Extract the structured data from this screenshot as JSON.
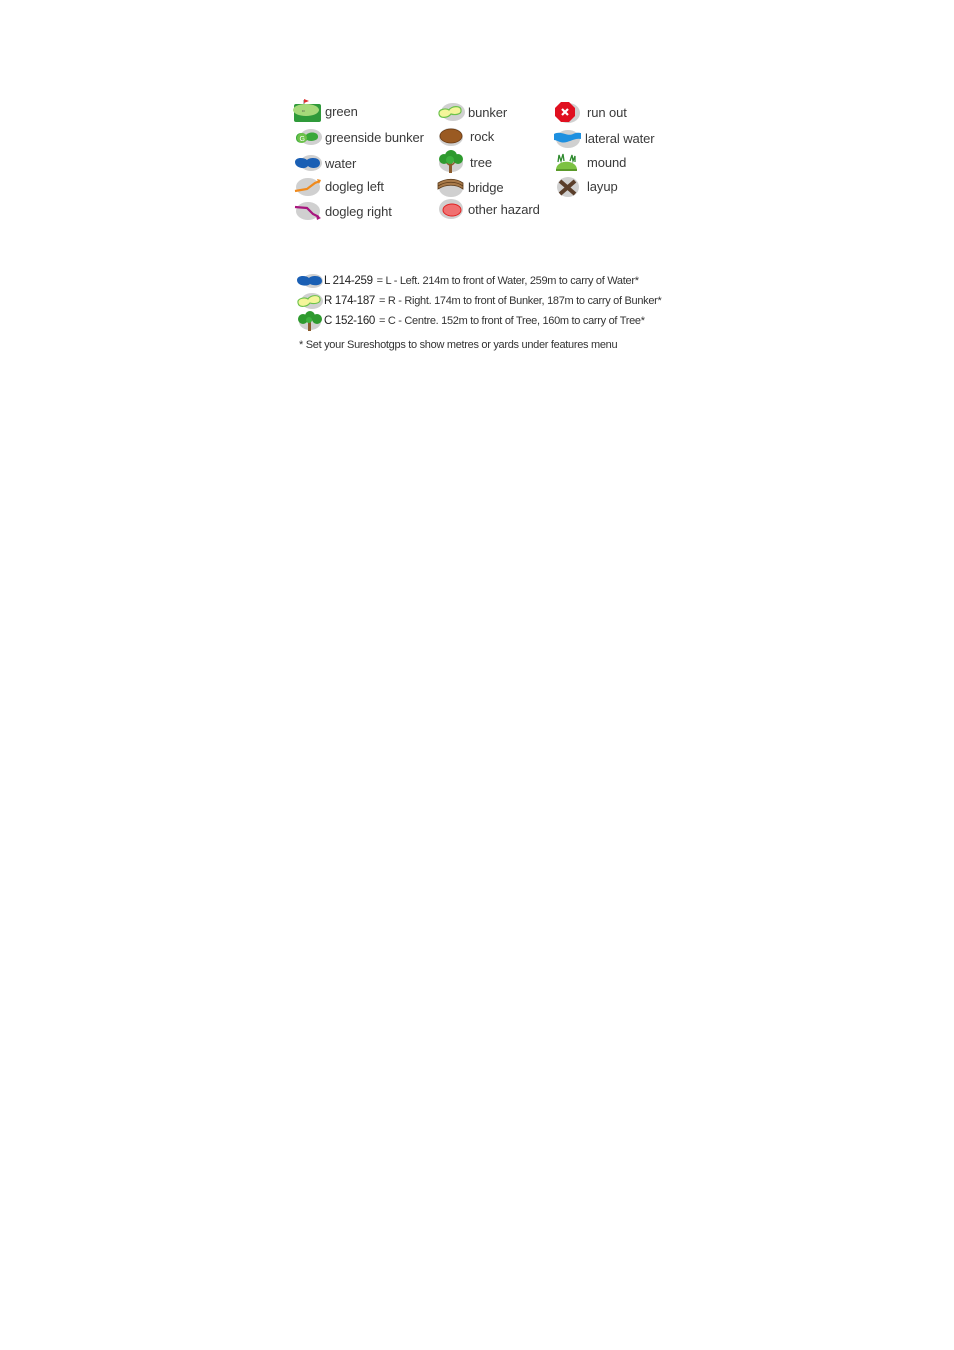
{
  "legend": {
    "columns": [
      {
        "items": [
          {
            "icon": "green-icon",
            "label": "green"
          },
          {
            "icon": "greenside-bunker-icon",
            "label": "greenside bunker"
          },
          {
            "icon": "water-icon",
            "label": "water"
          },
          {
            "icon": "dogleg-left-icon",
            "label": "dogleg left"
          },
          {
            "icon": "dogleg-right-icon",
            "label": "dogleg right"
          }
        ]
      },
      {
        "items": [
          {
            "icon": "bunker-icon",
            "label": "bunker"
          },
          {
            "icon": "rock-icon",
            "label": "rock"
          },
          {
            "icon": "tree-icon",
            "label": "tree"
          },
          {
            "icon": "bridge-icon",
            "label": "bridge"
          },
          {
            "icon": "other-hazard-icon",
            "label": "other hazard"
          }
        ]
      },
      {
        "items": [
          {
            "icon": "run-out-icon",
            "label": "run out"
          },
          {
            "icon": "lateral-water-icon",
            "label": "lateral water"
          },
          {
            "icon": "mound-icon",
            "label": "mound"
          },
          {
            "icon": "layup-icon",
            "label": "layup"
          }
        ]
      }
    ]
  },
  "examples": [
    {
      "icon": "water-icon",
      "code": "L 214-259",
      "description": "= L - Left. 214m to front of Water, 259m to carry of Water*"
    },
    {
      "icon": "bunker-icon",
      "code": "R 174-187",
      "description": "= R - Right. 174m to front of Bunker, 187m to carry of Bunker*"
    },
    {
      "icon": "tree-icon",
      "code": "C 152-160",
      "description": "= C - Centre. 152m to front of Tree, 160m to carry of Tree*"
    }
  ],
  "footnote": "* Set your Sureshotgps to show metres or yards under features menu",
  "colors": {
    "green": "#3aa83a",
    "green_light": "#a6d97a",
    "water": "#1a5fb4",
    "bunker_fill": "#f4f59a",
    "hazard_grey": "#d0d0d0",
    "dogleg_left": "#f08a1c",
    "dogleg_right": "#a8157e",
    "rock": "#9a5a22",
    "bridge": "#a87a4a",
    "other_hazard": "#f07070",
    "run_out": "#e01020",
    "lateral_water": "#1e90e0",
    "mound": "#7cc242",
    "layup": "#5a3e2a"
  }
}
